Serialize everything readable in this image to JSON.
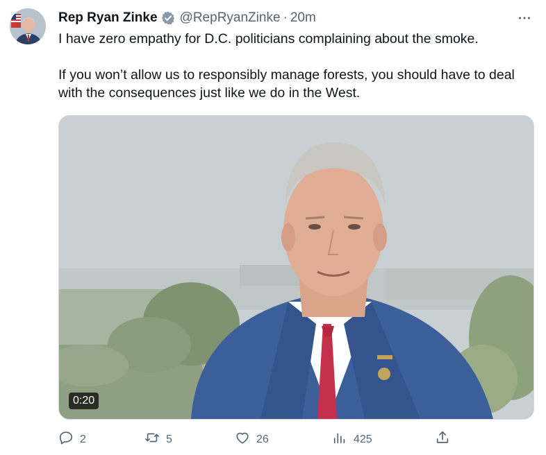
{
  "tweet": {
    "author_name": "Rep Ryan Zinke",
    "handle": "@RepRyanZinke",
    "separator": "·",
    "time": "20m",
    "paragraphs": [
      "I have zero empathy for D.C. politicians complaining about the smoke.",
      "If you won’t allow us to responsibly manage forests, you should have to deal with the consequences just like we do in the West."
    ],
    "video_duration": "0:20"
  },
  "actions": {
    "replies": "2",
    "reposts": "5",
    "likes": "26",
    "views": "425"
  },
  "icons": {
    "verified": "verified-badge-icon",
    "more": "more-icon",
    "reply": "reply-icon",
    "repost": "repost-icon",
    "like": "like-icon",
    "views": "views-icon",
    "share": "share-icon"
  },
  "colors": {
    "text": "#0f1419",
    "secondary": "#536471",
    "verified_badge": "#829aab"
  }
}
